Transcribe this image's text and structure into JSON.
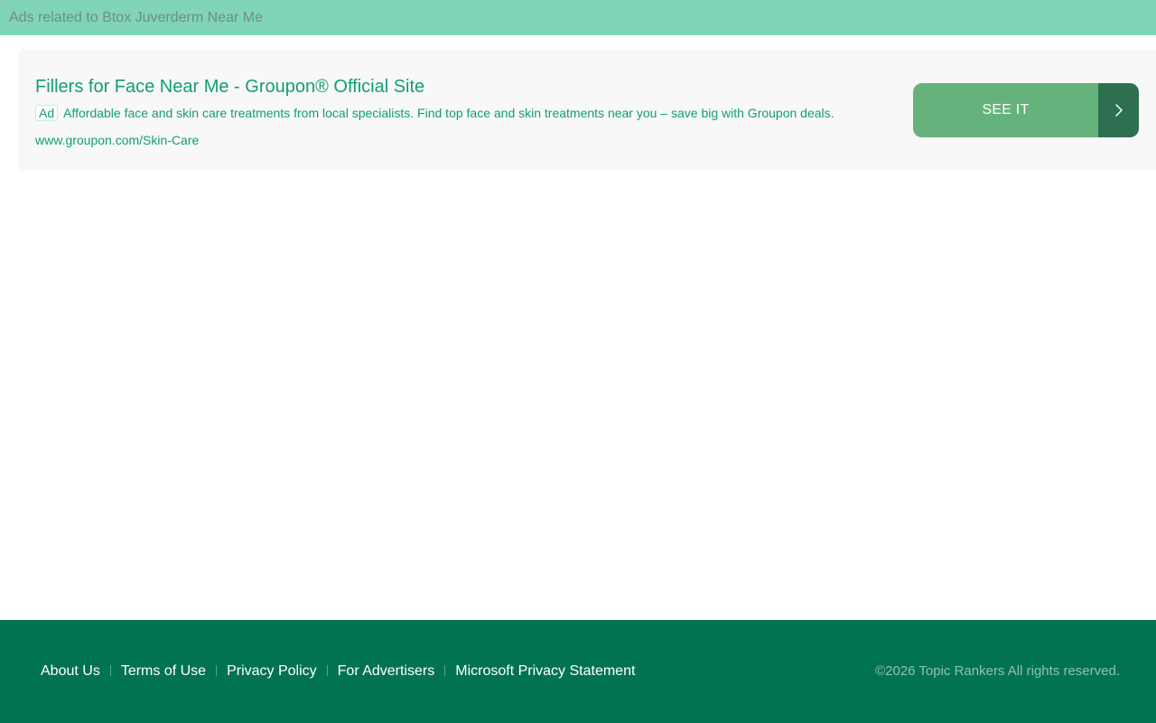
{
  "header": {
    "text": "Ads related to Btox Juverderm Near Me",
    "bg_color": "#7fd4b9"
  },
  "ad": {
    "title": "Fillers for Face Near Me - Groupon® Official Site",
    "badge": "Ad",
    "description": "Affordable face and skin care treatments from local specialists. Find top face and skin treatments near you – save big with Groupon deals.",
    "url": "www.groupon.com/Skin-Care",
    "cta_label": "SEE IT",
    "cta_icon": "chevron-right-icon",
    "text_color": "#12a06a",
    "cta_color": "#66b27c",
    "cta_arrow_color": "#2d7050"
  },
  "footer": {
    "links": [
      {
        "label": "About Us"
      },
      {
        "label": "Terms of Use"
      },
      {
        "label": "Privacy Policy"
      },
      {
        "label": "For Advertisers"
      },
      {
        "label": "Microsoft Privacy Statement"
      }
    ],
    "copyright": "©2026 Topic Rankers All rights reserved.",
    "bg_color": "#027350"
  }
}
